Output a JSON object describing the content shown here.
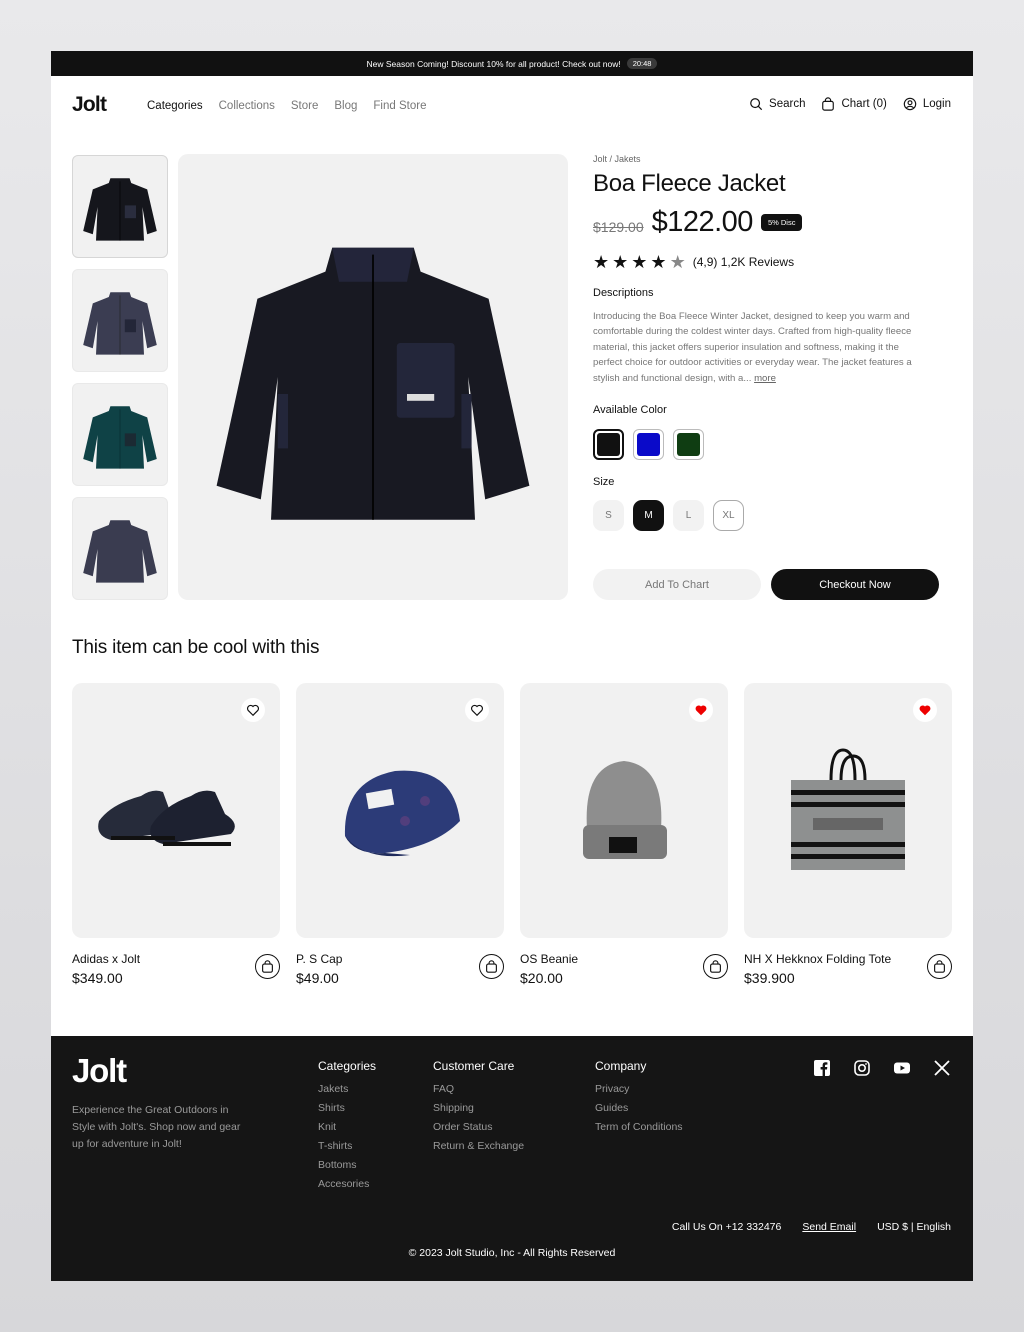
{
  "announcement": {
    "text": "New Season Coming! Discount 10% for all product! Check out now!",
    "timer": "20:48"
  },
  "header": {
    "logo": "Jolt",
    "nav": [
      "Categories",
      "Collections",
      "Store",
      "Blog",
      "Find Store"
    ],
    "active_nav": "Categories",
    "search_label": "Search",
    "cart_label": "Chart (0)",
    "login_label": "Login"
  },
  "product": {
    "breadcrumb": "Jolt / Jakets",
    "title": "Boa Fleece Jacket",
    "old_price": "$129.00",
    "price": "$122.00",
    "discount_badge": "5% Disc",
    "rating": 4,
    "rating_text": "(4,9) 1,2K Reviews",
    "descriptions_heading": "Descriptions",
    "description": "Introducing the Boa Fleece Winter Jacket, designed to keep you warm and comfortable during the coldest winter days. Crafted from high-quality fleece material, this jacket offers superior insulation and softness, making it the perfect choice for outdoor activities or everyday wear. The jacket features a stylish and functional design, with a...",
    "more_label": "more",
    "color_heading": "Available Color",
    "colors": [
      "#111111",
      "#0a0ac9",
      "#0f3d12"
    ],
    "selected_color": 0,
    "size_heading": "Size",
    "sizes": [
      "S",
      "M",
      "L",
      "XL"
    ],
    "selected_size": "M",
    "add_to_cart_label": "Add To Chart",
    "checkout_label": "Checkout Now",
    "thumbnail_colors": [
      "#15161c",
      "#3b3d52",
      "#0f4246",
      "#3a3c50"
    ]
  },
  "related": {
    "title": "This item can be cool with this",
    "items": [
      {
        "name": "Adidas x Jolt",
        "price": "$349.00",
        "favorited": false
      },
      {
        "name": "P. S Cap",
        "price": "$49.00",
        "favorited": false
      },
      {
        "name": "OS Beanie",
        "price": "$20.00",
        "favorited": true
      },
      {
        "name": "NH X Hekknox Folding Tote",
        "price": "$39.900",
        "favorited": true
      }
    ]
  },
  "footer": {
    "logo": "Jolt",
    "tagline": "Experience the Great Outdoors in Style with Jolt's. Shop now and gear up for adventure in Jolt!",
    "categories": {
      "title": "Categories",
      "items": [
        "Jakets",
        "Shirts",
        "Knit",
        "T-shirts",
        "Bottoms",
        "Accesories"
      ]
    },
    "customer_care": {
      "title": "Customer Care",
      "items": [
        "FAQ",
        "Shipping",
        "Order Status",
        "Return & Exchange"
      ]
    },
    "company": {
      "title": "Company",
      "items": [
        "Privacy",
        "Guides",
        "Term of Conditions"
      ]
    },
    "socials": [
      "facebook-icon",
      "instagram-icon",
      "youtube-icon",
      "x-icon"
    ],
    "phone": "Call Us On +12 332476",
    "email": "Send Email",
    "locale": "USD $ | English",
    "copyright": "© 2023 Jolt Studio, Inc - All Rights Reserved"
  }
}
